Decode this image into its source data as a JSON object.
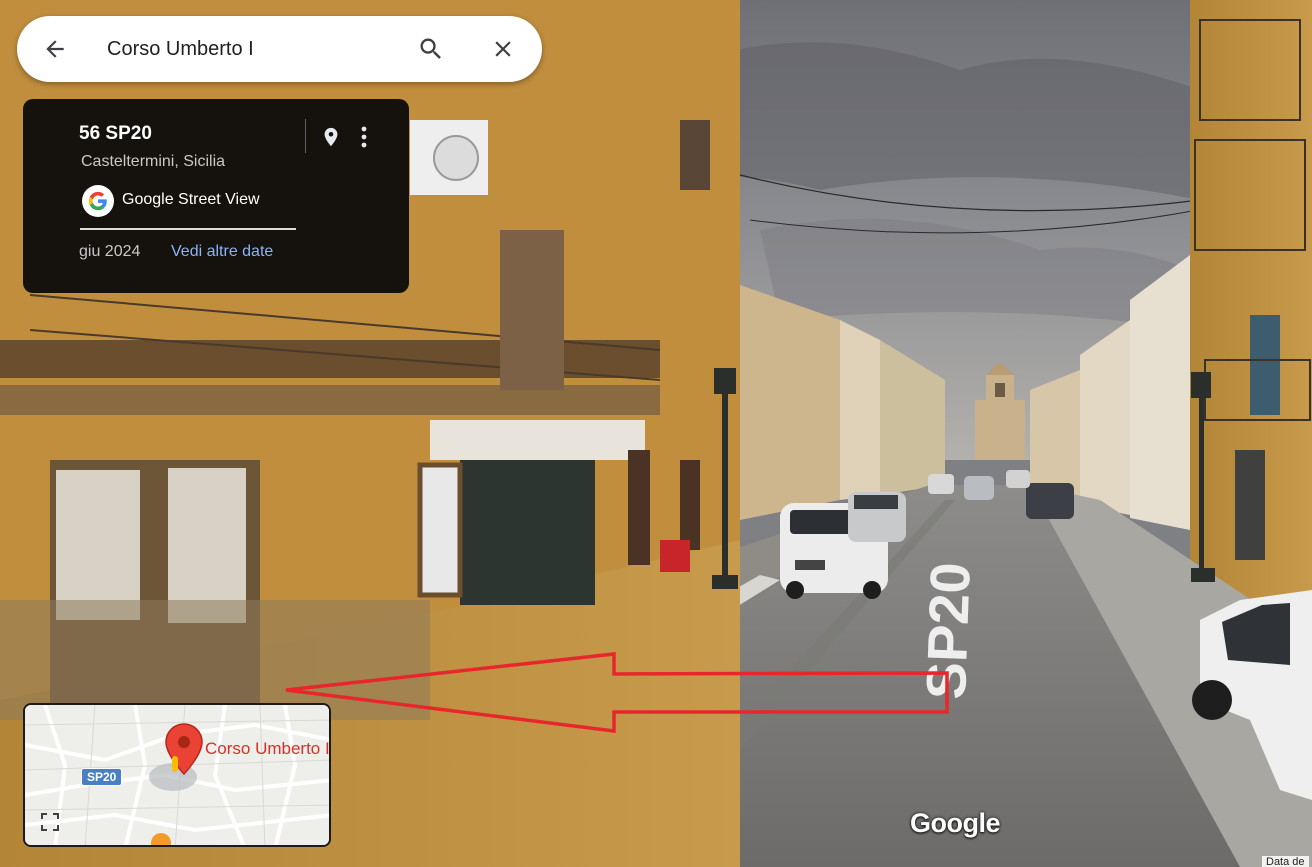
{
  "search": {
    "value": "Corso Umberto I",
    "back_icon": "arrow-left-icon",
    "search_icon": "search-icon",
    "close_icon": "close-icon"
  },
  "info_card": {
    "title": "56 SP20",
    "subtitle": "Casteltermini, Sicilia",
    "provider": "Google Street View",
    "capture_date": "giu 2024",
    "more_dates_link": "Vedi altre date",
    "link_color": "#8ab4f8"
  },
  "minimap": {
    "road_label": "SP20",
    "place_label": "Corso Umberto I"
  },
  "scene": {
    "road_marking": "SP20",
    "annotation_color": "#e8262b"
  },
  "watermark": "Google",
  "footer": {
    "data_link": "Data de"
  }
}
